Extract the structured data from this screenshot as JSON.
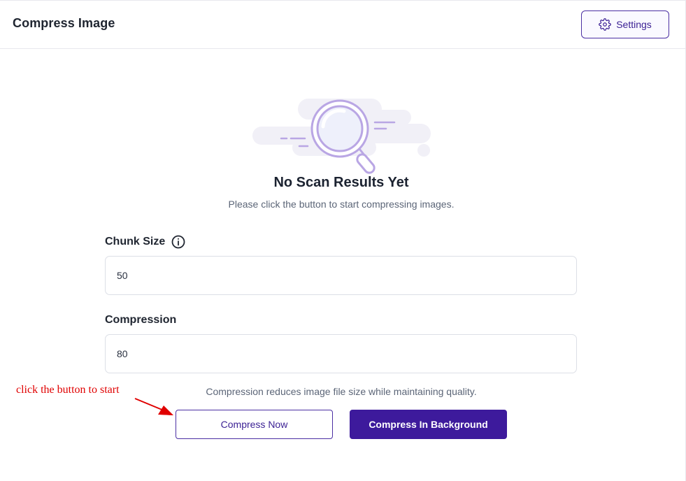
{
  "header": {
    "title": "Compress Image",
    "settings_label": "Settings",
    "settings_icon": "gear-icon"
  },
  "empty_state": {
    "icon": "magnifier-illustration",
    "title": "No Scan Results Yet",
    "subtitle": "Please click the button to start compressing images."
  },
  "form": {
    "chunk_size": {
      "label": "Chunk Size",
      "value": "50",
      "info_icon": "info-icon"
    },
    "compression": {
      "label": "Compression",
      "value": "80",
      "help": "Compression reduces image file size while maintaining quality."
    }
  },
  "actions": {
    "compress_now": "Compress Now",
    "compress_background": "Compress In Background"
  },
  "annotation": {
    "text": "click the button to start",
    "color": "#e00000"
  },
  "colors": {
    "accent": "#3d1a9c",
    "illustration": "#b9a6e4"
  }
}
